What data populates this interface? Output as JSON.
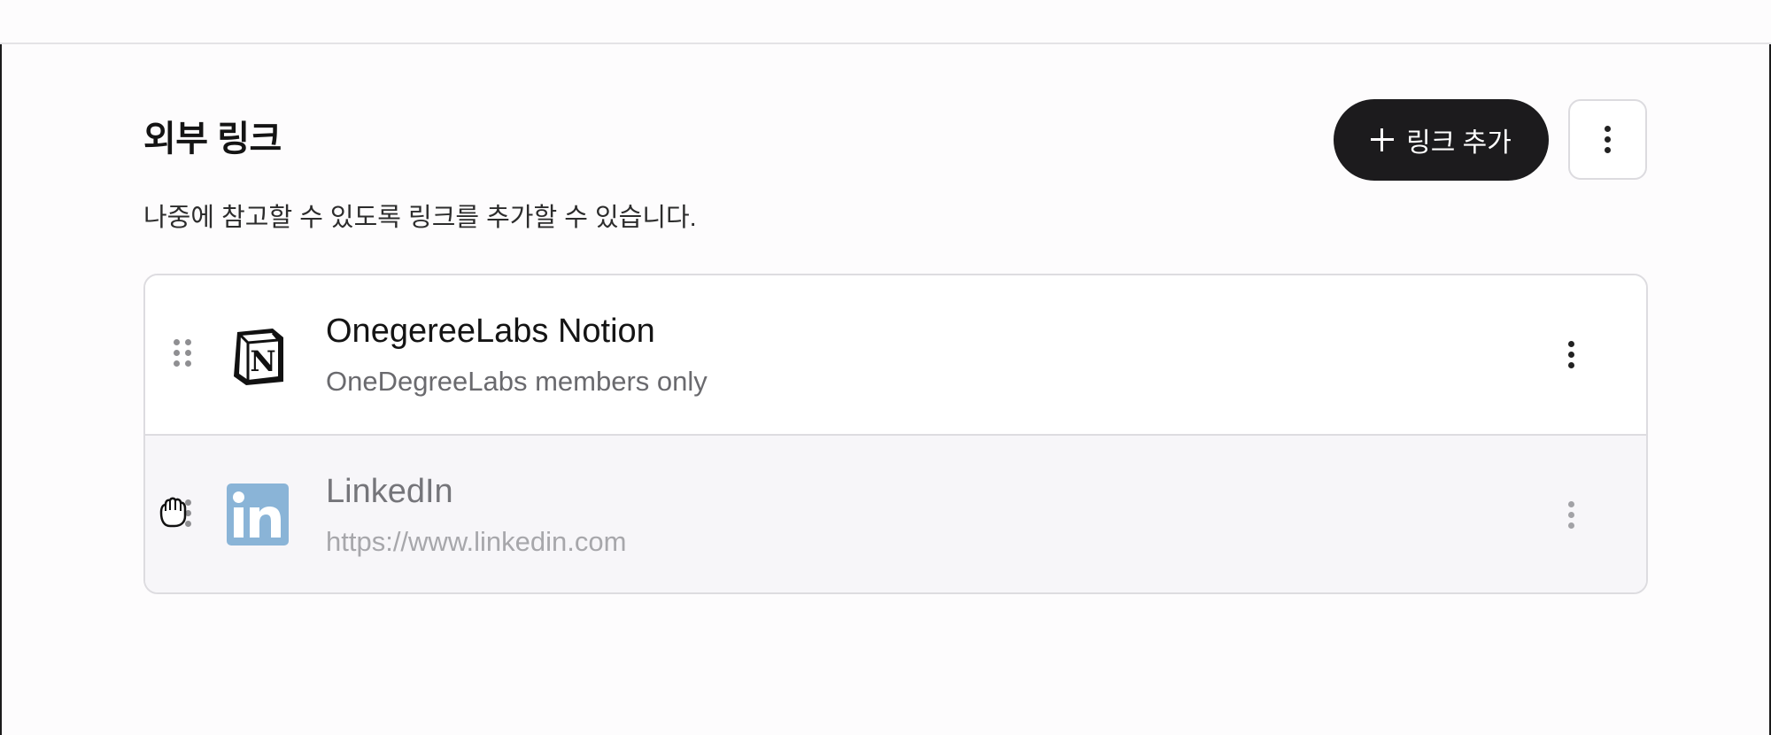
{
  "section": {
    "title": "외부 링크",
    "subtitle": "나중에 참고할 수 있도록 링크를 추가할 수 있습니다."
  },
  "toolbar": {
    "add_link_label": "링크 추가",
    "add_icon": "plus-icon",
    "more_icon": "vertical-ellipsis-icon"
  },
  "links": [
    {
      "title": "OnegereeLabs Notion",
      "description": "OneDegreeLabs members only",
      "icon": "notion-logo-icon"
    },
    {
      "title": "LinkedIn",
      "description": "https://www.linkedin.com",
      "icon": "linkedin-logo-icon",
      "icon_color": "#8ab4d7"
    }
  ],
  "colors": {
    "primary_button": "#1c1b1d",
    "dragging_row_bg": "#f7f6f9"
  }
}
